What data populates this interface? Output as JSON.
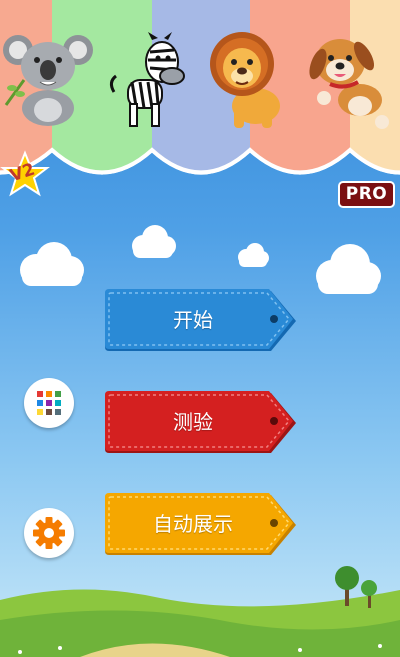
{
  "header": {
    "animals": [
      {
        "name": "koala"
      },
      {
        "name": "zebra"
      },
      {
        "name": "lion"
      },
      {
        "name": "puppy"
      }
    ],
    "version_badge": "V2",
    "pro_badge": "PRO"
  },
  "menu": {
    "start_label": "开始",
    "quiz_label": "测验",
    "autoplay_label": "自动展示",
    "start_color": "#1f7fc9",
    "quiz_color": "#d42020",
    "autoplay_color": "#f5a700"
  },
  "side_buttons": {
    "grid_icon": "grid-icon",
    "settings_icon": "gear-icon"
  }
}
